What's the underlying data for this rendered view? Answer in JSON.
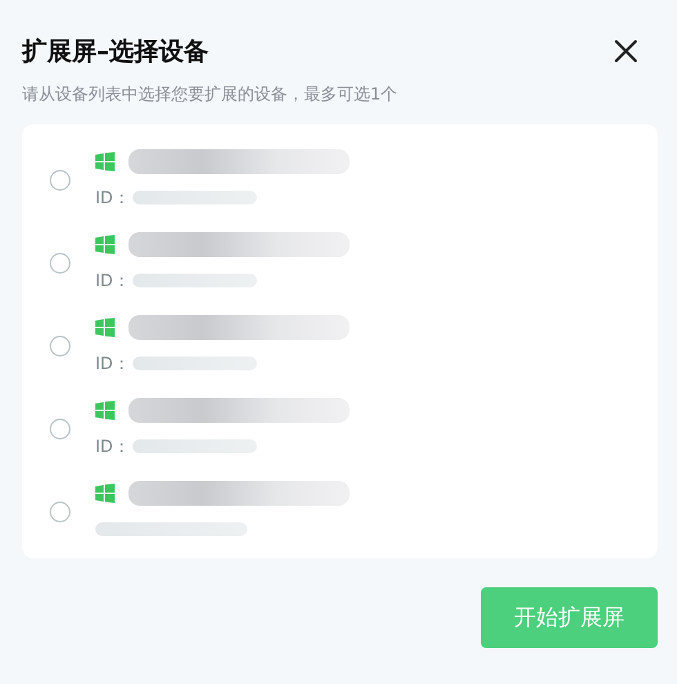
{
  "dialog": {
    "title": "扩展屏–选择设备",
    "subtitle": "请从设备列表中选择您要扩展的设备，最多可选1个"
  },
  "devices": [
    {
      "selected": false,
      "id_label": "ID："
    },
    {
      "selected": false,
      "id_label": "ID："
    },
    {
      "selected": false,
      "id_label": "ID："
    },
    {
      "selected": false,
      "id_label": "ID："
    },
    {
      "selected": false
    }
  ],
  "buttons": [
    {
      "label": "开始扩展屏"
    }
  ]
}
